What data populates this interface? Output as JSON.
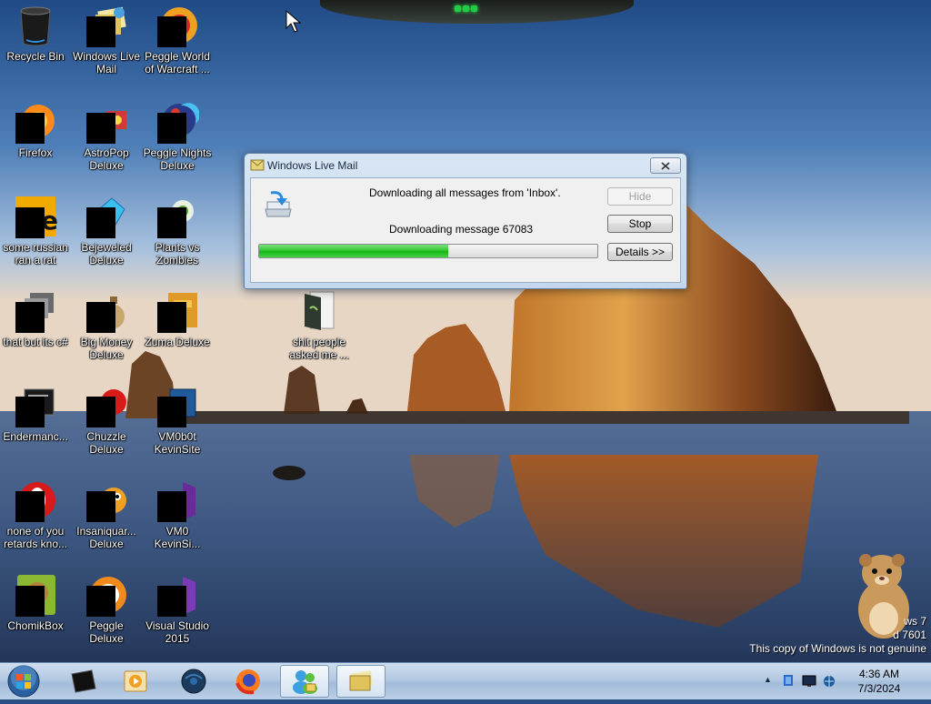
{
  "desktop": {
    "icons": [
      {
        "id": "recycle-bin",
        "label": "Recycle Bin"
      },
      {
        "id": "windows-live-mail",
        "label": "Windows Live Mail"
      },
      {
        "id": "peggle-world-of-warcraft",
        "label": "Peggle World of Warcraft ..."
      },
      {
        "id": "firefox",
        "label": "Firefox"
      },
      {
        "id": "astropop-deluxe",
        "label": "AstroPop Deluxe"
      },
      {
        "id": "peggle-nights-deluxe",
        "label": "Peggle Nights Deluxe"
      },
      {
        "id": "some-russian-ran-a-rat",
        "label": "some russian ran a rat"
      },
      {
        "id": "bejeweled-deluxe",
        "label": "Bejeweled Deluxe"
      },
      {
        "id": "plants-vs-zombies",
        "label": "Plants vs Zombies"
      },
      {
        "id": "that-but-its-csharp",
        "label": "that but its c#"
      },
      {
        "id": "big-money-deluxe",
        "label": "Big Money Deluxe"
      },
      {
        "id": "zuma-deluxe",
        "label": "Zuma Deluxe"
      },
      {
        "id": "shit-people-asked-me",
        "label": "shit people asked me ..."
      },
      {
        "id": "endermanch",
        "label": "Endermanc..."
      },
      {
        "id": "chuzzle-deluxe",
        "label": "Chuzzle Deluxe"
      },
      {
        "id": "vm0b0t-kevinsite",
        "label": "VM0b0t KevinSite"
      },
      {
        "id": "none-of-you-retards-kno",
        "label": "none of you retards kno..."
      },
      {
        "id": "insaniquarium-deluxe",
        "label": "Insaniquar... Deluxe"
      },
      {
        "id": "vm0-kevinsi",
        "label": "VM0 KevinSi..."
      },
      {
        "id": "chomikbox",
        "label": "ChomikBox"
      },
      {
        "id": "peggle-deluxe",
        "label": "Peggle Deluxe"
      },
      {
        "id": "visual-studio-2015",
        "label": "Visual Studio 2015"
      }
    ]
  },
  "dialog": {
    "title": "Windows Live Mail",
    "status_line": "Downloading all messages from 'Inbox'.",
    "progress_line": "Downloading message 67083",
    "progress_fraction": 0.56,
    "buttons": {
      "hide": "Hide",
      "stop": "Stop",
      "details": "Details >>"
    }
  },
  "watermark": {
    "line1": "ws 7",
    "line2": "d 7601",
    "line3": "This copy of Windows is not genuine"
  },
  "taskbar": {
    "clock_time": "4:36 AM",
    "clock_date": "7/3/2024",
    "tray_expand": "▲"
  },
  "colors": {
    "progress_green": "#16b816",
    "taskbar": "#b3c9e2",
    "dialog_frame": "#c4d7ec"
  }
}
